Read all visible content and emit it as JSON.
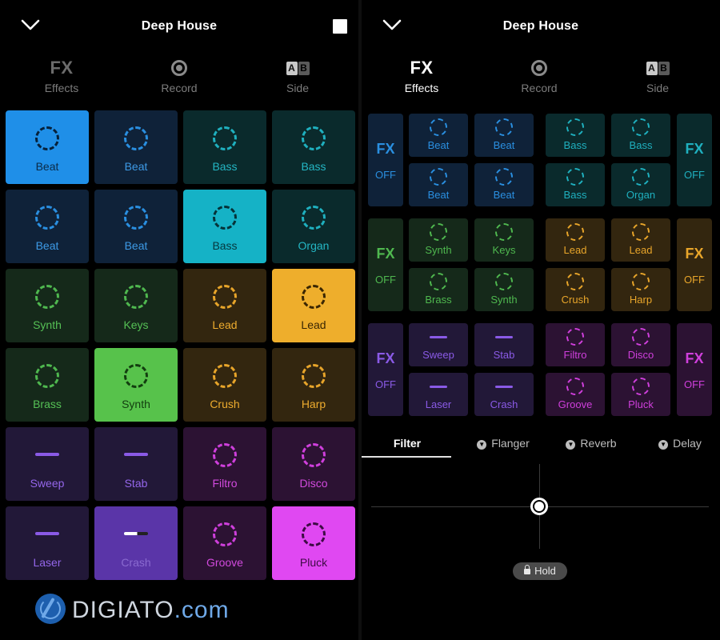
{
  "left": {
    "title": "Deep House",
    "modes": [
      {
        "glyph": "FX",
        "label": "Effects",
        "active": false
      },
      {
        "glyph": "",
        "label": "Record"
      },
      {
        "glyph_a": "A",
        "glyph_b": "B",
        "label": "Side"
      }
    ],
    "pads": [
      {
        "label": "Beat",
        "icon": "ring",
        "bg": "#1f8fe8",
        "fg": "#06213a",
        "text": "#0b2a46",
        "active": true
      },
      {
        "label": "Beat",
        "icon": "ring",
        "bg": "#0f2239",
        "fg": "#2a8fe0",
        "text": "#3d9ae6"
      },
      {
        "label": "Bass",
        "icon": "ring",
        "bg": "#0a2a2c",
        "fg": "#1fb0bf",
        "text": "#24b6c4"
      },
      {
        "label": "Bass",
        "icon": "ring",
        "bg": "#0a2a2c",
        "fg": "#1fb0bf",
        "text": "#24b6c4"
      },
      {
        "label": "Beat",
        "icon": "ring",
        "bg": "#0f2239",
        "fg": "#2a8fe0",
        "text": "#3d9ae6"
      },
      {
        "label": "Beat",
        "icon": "ring",
        "bg": "#0f2239",
        "fg": "#2a8fe0",
        "text": "#3d9ae6"
      },
      {
        "label": "Bass",
        "icon": "ring",
        "bg": "#15b2c6",
        "fg": "#053238",
        "text": "#06363c",
        "active": true
      },
      {
        "label": "Organ",
        "icon": "ring",
        "bg": "#0a2a2c",
        "fg": "#1fb0bf",
        "text": "#24b6c4"
      },
      {
        "label": "Synth",
        "icon": "ring",
        "bg": "#15291a",
        "fg": "#4fb84f",
        "text": "#55c055"
      },
      {
        "label": "Keys",
        "icon": "ring",
        "bg": "#15291a",
        "fg": "#4fb84f",
        "text": "#55c055"
      },
      {
        "label": "Lead",
        "icon": "ring",
        "bg": "#33260f",
        "fg": "#e8a52a",
        "text": "#eeac2e"
      },
      {
        "label": "Lead",
        "icon": "ring",
        "bg": "#eeae2c",
        "fg": "#3a2603",
        "text": "#3a2603",
        "active": true
      },
      {
        "label": "Brass",
        "icon": "ring",
        "bg": "#15291a",
        "fg": "#4fb84f",
        "text": "#55c055"
      },
      {
        "label": "Synth",
        "icon": "ring",
        "bg": "#57c24b",
        "fg": "#123d0f",
        "text": "#123d0f",
        "active": true
      },
      {
        "label": "Crush",
        "icon": "ring",
        "bg": "#33260f",
        "fg": "#e8a52a",
        "text": "#eeac2e"
      },
      {
        "label": "Harp",
        "icon": "ring",
        "bg": "#33260f",
        "fg": "#e8a52a",
        "text": "#eeac2e"
      },
      {
        "label": "Sweep",
        "icon": "dash",
        "bg": "#221838",
        "fg": "#8a5ae6",
        "text": "#9466ea"
      },
      {
        "label": "Stab",
        "icon": "dash",
        "bg": "#221838",
        "fg": "#8a5ae6",
        "text": "#9466ea"
      },
      {
        "label": "Filtro",
        "icon": "ring",
        "bg": "#2c1233",
        "fg": "#cf3fdc",
        "text": "#d24ade"
      },
      {
        "label": "Disco",
        "icon": "ring",
        "bg": "#2c1233",
        "fg": "#cf3fdc",
        "text": "#d24ade"
      },
      {
        "label": "Laser",
        "icon": "dash",
        "bg": "#221838",
        "fg": "#8a5ae6",
        "text": "#9466ea"
      },
      {
        "label": "Crash",
        "icon": "dash-half",
        "bg": "#5a35a8",
        "fg": "#ffffff",
        "text": "#8a6ad0",
        "active": true
      },
      {
        "label": "Groove",
        "icon": "ring",
        "bg": "#2c1233",
        "fg": "#cf3fdc",
        "text": "#d24ade"
      },
      {
        "label": "Pluck",
        "icon": "ring",
        "bg": "#e048f2",
        "fg": "#3d0b44",
        "text": "#3d0b44",
        "active": true
      }
    ]
  },
  "right": {
    "title": "Deep House",
    "modes": [
      {
        "glyph": "FX",
        "label": "Effects",
        "active": true
      },
      {
        "glyph": "",
        "label": "Record"
      },
      {
        "glyph_a": "A",
        "glyph_b": "B",
        "label": "Side"
      }
    ],
    "fx_groups": [
      {
        "fx": "FX",
        "state": "OFF",
        "color": "#2a8fe0",
        "bg": "#0f2239"
      },
      {
        "fx": "FX",
        "state": "OFF",
        "color": "#1fb0bf",
        "bg": "#0a2a2c"
      },
      {
        "fx": "FX",
        "state": "OFF",
        "color": "#4fb84f",
        "bg": "#15291a"
      },
      {
        "fx": "FX",
        "state": "OFF",
        "color": "#e8a52a",
        "bg": "#33260f"
      },
      {
        "fx": "FX",
        "state": "OFF",
        "color": "#8a5ae6",
        "bg": "#221838"
      },
      {
        "fx": "FX",
        "state": "OFF",
        "color": "#cf3fdc",
        "bg": "#2c1233"
      }
    ],
    "mini_pads": [
      {
        "label": "Beat",
        "icon": "ring",
        "color": "#2a8fe0",
        "bg": "#0f2239"
      },
      {
        "label": "Beat",
        "icon": "ring",
        "color": "#2a8fe0",
        "bg": "#0f2239"
      },
      {
        "label": "Bass",
        "icon": "ring",
        "color": "#1fb0bf",
        "bg": "#0a2a2c"
      },
      {
        "label": "Bass",
        "icon": "ring",
        "color": "#1fb0bf",
        "bg": "#0a2a2c"
      },
      {
        "label": "Beat",
        "icon": "ring",
        "color": "#2a8fe0",
        "bg": "#0f2239"
      },
      {
        "label": "Beat",
        "icon": "ring",
        "color": "#2a8fe0",
        "bg": "#0f2239"
      },
      {
        "label": "Bass",
        "icon": "ring",
        "color": "#1fb0bf",
        "bg": "#0a2a2c"
      },
      {
        "label": "Organ",
        "icon": "ring",
        "color": "#1fb0bf",
        "bg": "#0a2a2c"
      },
      {
        "label": "Synth",
        "icon": "ring",
        "color": "#4fb84f",
        "bg": "#15291a"
      },
      {
        "label": "Keys",
        "icon": "ring",
        "color": "#4fb84f",
        "bg": "#15291a"
      },
      {
        "label": "Lead",
        "icon": "ring",
        "color": "#e8a52a",
        "bg": "#33260f"
      },
      {
        "label": "Lead",
        "icon": "ring",
        "color": "#e8a52a",
        "bg": "#33260f"
      },
      {
        "label": "Brass",
        "icon": "ring",
        "color": "#4fb84f",
        "bg": "#15291a"
      },
      {
        "label": "Synth",
        "icon": "ring",
        "color": "#4fb84f",
        "bg": "#15291a"
      },
      {
        "label": "Crush",
        "icon": "ring",
        "color": "#e8a52a",
        "bg": "#33260f"
      },
      {
        "label": "Harp",
        "icon": "ring",
        "color": "#e8a52a",
        "bg": "#33260f"
      },
      {
        "label": "Sweep",
        "icon": "dash",
        "color": "#8a5ae6",
        "bg": "#221838"
      },
      {
        "label": "Stab",
        "icon": "dash",
        "color": "#8a5ae6",
        "bg": "#221838"
      },
      {
        "label": "Filtro",
        "icon": "ring",
        "color": "#cf3fdc",
        "bg": "#2c1233"
      },
      {
        "label": "Disco",
        "icon": "ring",
        "color": "#cf3fdc",
        "bg": "#2c1233"
      },
      {
        "label": "Laser",
        "icon": "dash",
        "color": "#8a5ae6",
        "bg": "#221838"
      },
      {
        "label": "Crash",
        "icon": "dash",
        "color": "#8a5ae6",
        "bg": "#221838"
      },
      {
        "label": "Groove",
        "icon": "ring",
        "color": "#cf3fdc",
        "bg": "#2c1233"
      },
      {
        "label": "Pluck",
        "icon": "ring",
        "color": "#cf3fdc",
        "bg": "#2c1233"
      }
    ],
    "effect_tabs": [
      {
        "label": "Filter",
        "active": true
      },
      {
        "label": "Flanger"
      },
      {
        "label": "Reverb"
      },
      {
        "label": "Delay"
      }
    ],
    "hold_label": "Hold"
  },
  "watermark": {
    "name": "DIGIATO",
    "suffix": ".com"
  }
}
